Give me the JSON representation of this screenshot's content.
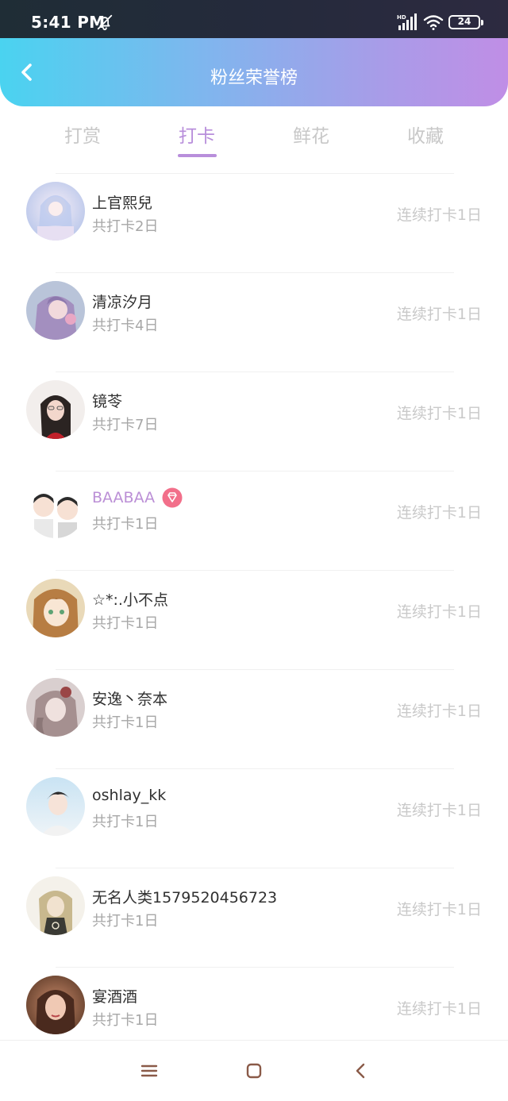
{
  "status_bar": {
    "time": "5:41 PM",
    "battery": "24"
  },
  "header": {
    "title": "粉丝荣誉榜"
  },
  "tabs": [
    {
      "label": "打赏"
    },
    {
      "label": "打卡"
    },
    {
      "label": "鲜花"
    },
    {
      "label": "收藏"
    }
  ],
  "active_tab": "打卡",
  "fans": [
    {
      "name": "上官熙兒",
      "total": "共打卡2日",
      "streak": "连续打卡1日"
    },
    {
      "name": "清凉汐月",
      "total": "共打卡4日",
      "streak": "连续打卡1日"
    },
    {
      "name": "镜苓",
      "total": "共打卡7日",
      "streak": "连续打卡1日"
    },
    {
      "name": "BAABAA",
      "total": "共打卡1日",
      "streak": "连续打卡1日"
    },
    {
      "name": "☆*:.小不点",
      "total": "共打卡1日",
      "streak": "连续打卡1日"
    },
    {
      "name": "安逸丶奈本",
      "total": "共打卡1日",
      "streak": "连续打卡1日"
    },
    {
      "name": "oshlay_kk",
      "total": "共打卡1日",
      "streak": "连续打卡1日"
    },
    {
      "name": "无名人类1579520456723",
      "total": "共打卡1日",
      "streak": "连续打卡1日"
    },
    {
      "name": "宴酒酒",
      "total": "共打卡1日",
      "streak": "连续打卡1日"
    }
  ],
  "colors": {
    "accent": "#b88edb",
    "header_start": "#4ad3f0",
    "header_end": "#c08ee6",
    "vip_badge": "#f26f8a"
  }
}
